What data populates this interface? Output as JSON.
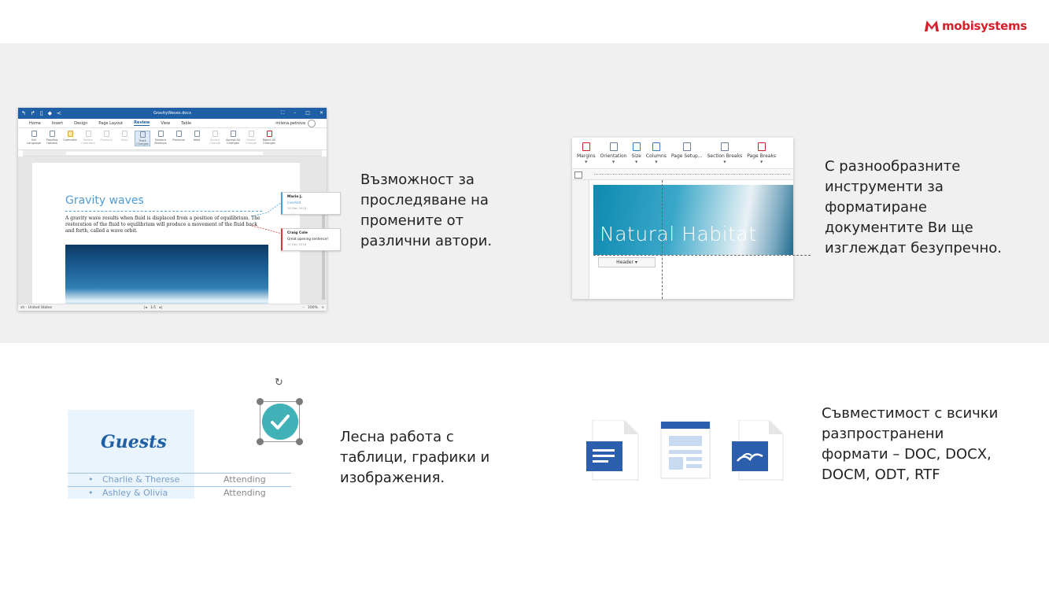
{
  "brand": {
    "name": "mobisystems",
    "color": "#d4202b",
    "logo_icon": "mobisystems-m-icon"
  },
  "colors": {
    "accent_blue": "#1f5fa5",
    "heading_blue": "#4f9bd4",
    "band_gray": "#f0f0f0",
    "teal": "#3fb1b7"
  },
  "features": [
    {
      "lines": [
        "Възможност за",
        "проследяване на",
        "промените от",
        "различни автори."
      ]
    },
    {
      "lines": [
        "С разнообразните",
        "инструменти за",
        "форматиране",
        "документите Ви ще",
        "изглеждат безупречно."
      ]
    },
    {
      "lines": [
        "Лесна работа с",
        "таблици, графики и",
        "изображения."
      ]
    },
    {
      "lines": [
        "Съвместимост с всички",
        "разпространени",
        "формати – DOC, DOCX,",
        "DOCM, ODT, RTF"
      ]
    }
  ],
  "editor": {
    "doc_name": "GravityWaves.docx",
    "menu": [
      "Home",
      "Insert",
      "Design",
      "Page Layout",
      "Review",
      "View",
      "Table"
    ],
    "active_menu": "Review",
    "user": "milena.petrova",
    "ribbon": [
      {
        "label": "Set Language",
        "style": ""
      },
      {
        "label": "Proofing Options",
        "style": ""
      },
      {
        "label": "Comment",
        "style": "comment"
      },
      {
        "label": "Delete Comment",
        "style": "dim"
      },
      {
        "label": "Previous",
        "style": "dim"
      },
      {
        "label": "Next",
        "style": "dim"
      },
      {
        "label": "Track Changes",
        "style": "on"
      },
      {
        "label": "Restore Markups",
        "style": ""
      },
      {
        "label": "Previous",
        "style": ""
      },
      {
        "label": "Next",
        "style": ""
      },
      {
        "label": "Accept Change",
        "style": "dim"
      },
      {
        "label": "Accept All Changes",
        "style": ""
      },
      {
        "label": "Reject Change",
        "style": "dim"
      },
      {
        "label": "Reject All Changes",
        "style": "red"
      }
    ],
    "heading": "Gravity waves",
    "paragraph": [
      "A gravity wave results when fluid is displaced from a position of equilibrium. The",
      "restoration of the fluid to equilibrium will produce a movement of the fluid back",
      "and forth, called a wave orbit."
    ],
    "comments": [
      {
        "author": "Mario J.",
        "text": "Inserted",
        "date": "10 Dec 2018"
      },
      {
        "author": "Craig Cole",
        "text": "Great opening sentence!",
        "date": "10 Dec 2018"
      }
    ],
    "status_left": "sh - United States",
    "status_page": "1/1",
    "status_zoom": "100%"
  },
  "layout_mock": {
    "ribbon": [
      {
        "label": "Margins",
        "caret": true,
        "style": "red"
      },
      {
        "label": "Orientation",
        "caret": true,
        "style": ""
      },
      {
        "label": "Size",
        "caret": true,
        "style": "blue"
      },
      {
        "label": "Columns",
        "caret": true,
        "style": "blue"
      },
      {
        "label": "Page Setup...",
        "caret": false,
        "style": ""
      },
      {
        "label": "Section Breaks",
        "caret": true,
        "style": ""
      },
      {
        "label": "Page Breaks",
        "caret": true,
        "style": "red"
      }
    ],
    "image_title": "Natural Habitat",
    "header_label": "Header ▾"
  },
  "guests_mock": {
    "title": "Guests",
    "rows": [
      {
        "name": "Charlie & Therese",
        "status": "Attending"
      },
      {
        "name": "Ashley & Olivia",
        "status": "Attending"
      }
    ]
  },
  "file_icons": [
    "word-doc-icon",
    "text-layout-icon",
    "writer-doc-icon"
  ]
}
